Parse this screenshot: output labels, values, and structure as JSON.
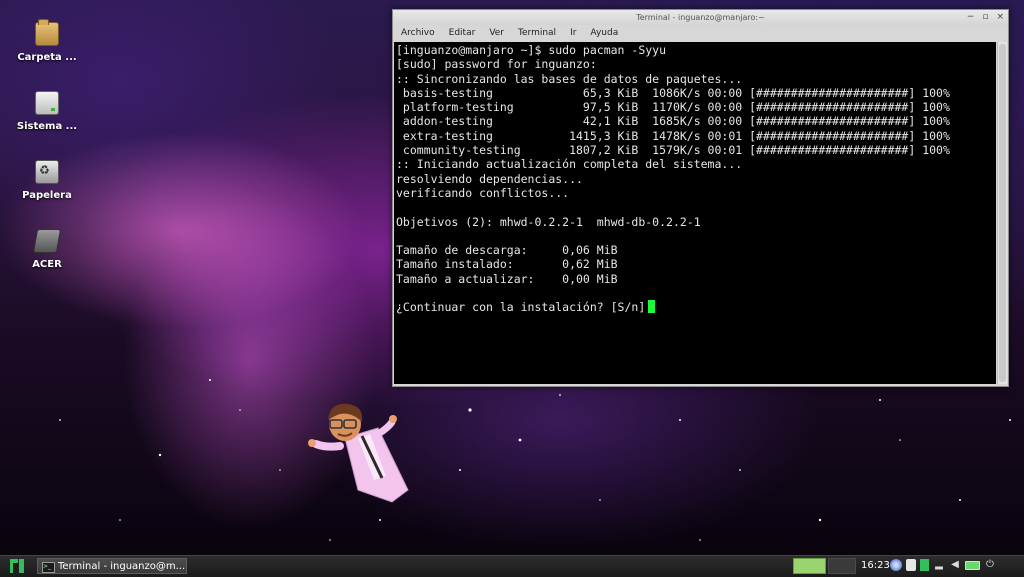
{
  "desktop": {
    "icons": [
      {
        "label": "Carpeta ..."
      },
      {
        "label": "Sistema ..."
      },
      {
        "label": "Papelera"
      },
      {
        "label": "ACER"
      }
    ]
  },
  "window": {
    "title": "Terminal - inguanzo@manjaro:~",
    "controls": {
      "minimize": "−",
      "maximize": "▫",
      "close": "×"
    },
    "menu": [
      "Archivo",
      "Editar",
      "Ver",
      "Terminal",
      "Ir",
      "Ayuda"
    ]
  },
  "terminal": {
    "lines": [
      "[inguanzo@manjaro ~]$ sudo pacman -Syyu",
      "[sudo] password for inguanzo:",
      ":: Sincronizando las bases de datos de paquetes...",
      " basis-testing             65,3 KiB  1086K/s 00:00 [######################] 100%",
      " platform-testing          97,5 KiB  1170K/s 00:00 [######################] 100%",
      " addon-testing             42,1 KiB  1685K/s 00:00 [######################] 100%",
      " extra-testing           1415,3 KiB  1478K/s 00:01 [######################] 100%",
      " community-testing       1807,2 KiB  1579K/s 00:01 [######################] 100%",
      ":: Iniciando actualización completa del sistema...",
      "resolviendo dependencias...",
      "verificando conflictos...",
      "",
      "Objetivos (2): mhwd-0.2.2-1  mhwd-db-0.2.2-1",
      "",
      "Tamaño de descarga:     0,06 MiB",
      "Tamaño instalado:       0,62 MiB",
      "Tamaño a actualizar:    0,00 MiB",
      ""
    ],
    "prompt": "¿Continuar con la instalación? [S/n]"
  },
  "taskbar": {
    "task_label": "Terminal - inguanzo@m...",
    "clock": "16:23",
    "tray_icons": [
      "disc-icon",
      "clipboard-icon",
      "manjaro-update-icon",
      "signal-icon",
      "volume-icon",
      "battery-icon",
      "power-icon"
    ]
  },
  "colors": {
    "cursor": "#19ff3a",
    "workspace_active": "#9bd36f",
    "manjaro_green": "#35bf5c"
  }
}
